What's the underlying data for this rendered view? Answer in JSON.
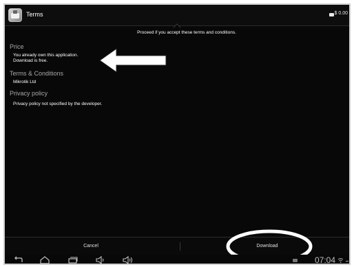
{
  "action_bar": {
    "title": "Terms",
    "price": "$ 0.00"
  },
  "notice": "Proceed if you accept these terms and conditions.",
  "sections": {
    "price": {
      "heading": "Price",
      "line1": "You already own this application.",
      "line2": "Download is free."
    },
    "terms": {
      "heading": "Terms & Conditions",
      "value": "Mikrotik Ltd"
    },
    "privacy": {
      "heading": "Privacy policy",
      "value": "Privacy policy not specified by the developer."
    }
  },
  "buttons": {
    "cancel": "Cancel",
    "download": "Download"
  },
  "status_bar": {
    "time": "07:04"
  },
  "icons": [
    "app-icon",
    "cart-icon",
    "back-icon",
    "home-icon",
    "recents-icon",
    "volume-down-icon",
    "volume-up-icon",
    "notification-icon",
    "wifi-icon"
  ],
  "colors": {
    "background": "#080808",
    "section_heading": "#a8a8a8",
    "text": "#ffffff",
    "annotation": "#ffffff"
  }
}
